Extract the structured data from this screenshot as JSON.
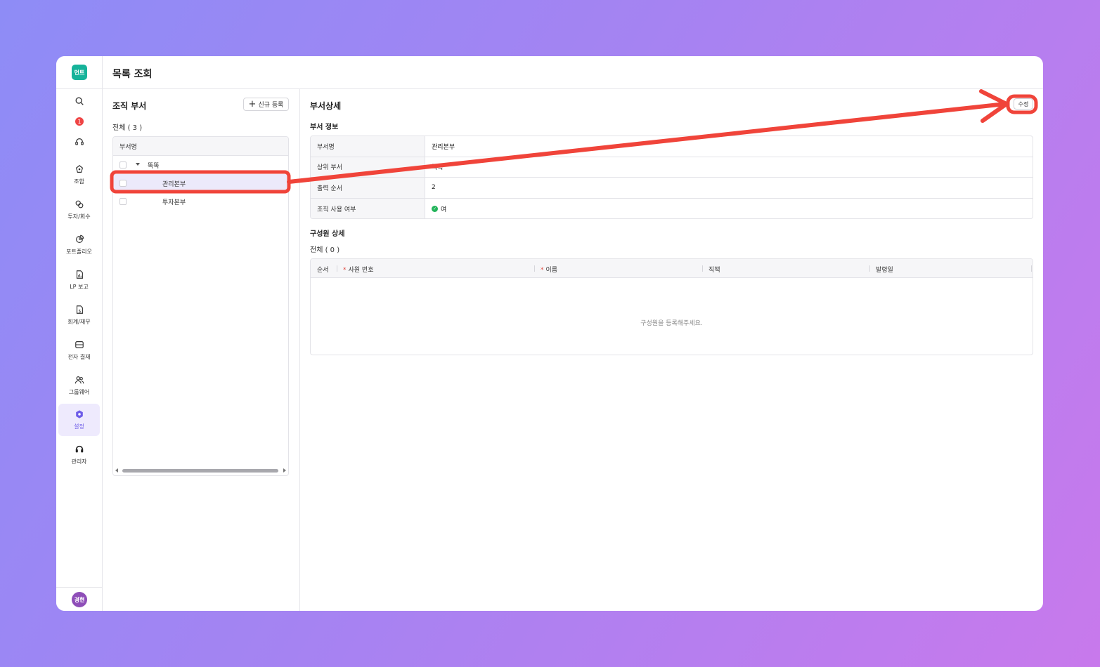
{
  "app": {
    "logo_text": "먼트",
    "badge_count": "1",
    "avatar_text": "경현"
  },
  "header": {
    "title": "목록 조회"
  },
  "sidebar": {
    "items": [
      {
        "label": "조합",
        "icon": "union-icon"
      },
      {
        "label": "투자/회수",
        "icon": "investment-icon"
      },
      {
        "label": "포트폴리오",
        "icon": "portfolio-icon"
      },
      {
        "label": "LP 보고",
        "icon": "report-icon"
      },
      {
        "label": "회계/재무",
        "icon": "accounting-icon"
      },
      {
        "label": "전자 결재",
        "icon": "approval-icon"
      },
      {
        "label": "그룹웨어",
        "icon": "groupware-icon"
      },
      {
        "label": "설정",
        "icon": "settings-icon",
        "active": true
      },
      {
        "label": "관리자",
        "icon": "admin-icon"
      }
    ]
  },
  "left_panel": {
    "title": "조직 부서",
    "new_button": "신규 등록",
    "count_label": "전체 ( 3 )",
    "tree_header": "부서명",
    "tree": [
      {
        "label": "똑똑",
        "level": 0,
        "expanded": true
      },
      {
        "label": "관리본부",
        "level": 1,
        "selected": true
      },
      {
        "label": "투자본부",
        "level": 1
      }
    ]
  },
  "detail": {
    "title": "부서상세",
    "edit_button": "수정",
    "info_section": "부서 정보",
    "info": [
      {
        "key": "부서명",
        "value": "관리본부"
      },
      {
        "key": "상위 부서",
        "value": "똑똑"
      },
      {
        "key": "출력 순서",
        "value": "2"
      },
      {
        "key": "조직 사용 여부",
        "value": "여"
      }
    ],
    "members_section": "구성원 상세",
    "members_count": "전체 ( 0 )",
    "members_columns": [
      "순서",
      "사원 번호",
      "이름",
      "직책",
      "발령일"
    ],
    "members_empty": "구성원을 등록해주세요."
  },
  "colors": {
    "accent": "#6d5ce8",
    "annotation": "#f0443a",
    "logo": "#16b39a",
    "success": "#22b45a"
  }
}
